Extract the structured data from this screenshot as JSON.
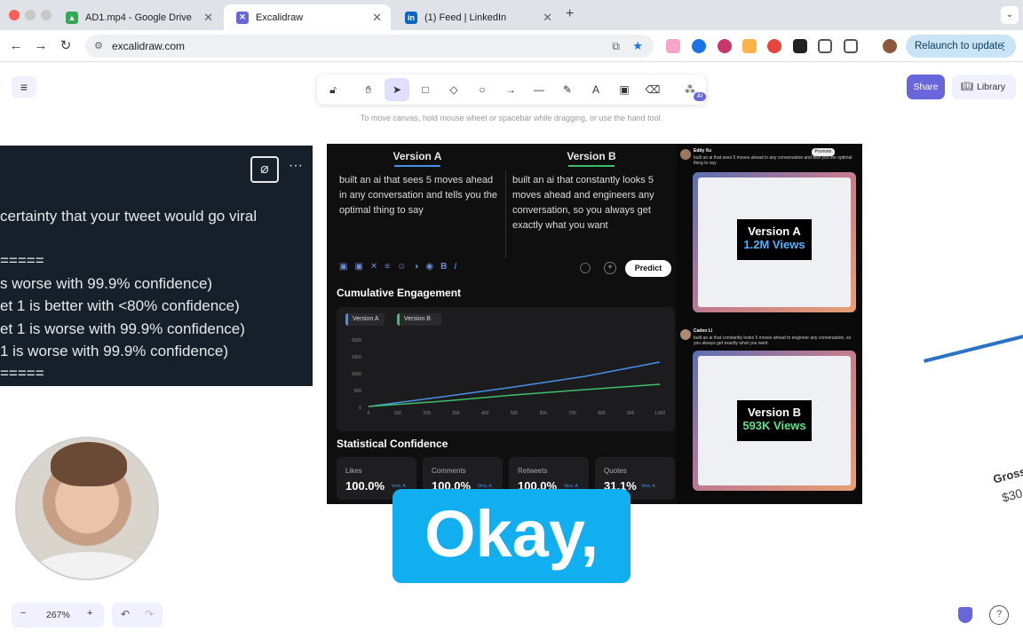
{
  "browser": {
    "tabs": [
      {
        "title": "AD1.mp4 - Google Drive",
        "active": false
      },
      {
        "title": "Excalidraw",
        "active": true
      },
      {
        "title": "(1) Feed | LinkedIn",
        "active": false
      }
    ],
    "url": "excalidraw.com",
    "relaunch_label": "Relaunch to update"
  },
  "excalidraw": {
    "hint": "To move canvas, hold mouse wheel or spacebar while dragging, or use the hand tool.",
    "share_label": "Share",
    "library_label": "Library",
    "zoom_level": "267%",
    "ai_badge": "AI"
  },
  "tweet_panel": {
    "lines": [
      "certainty that your tweet would go viral",
      "=====",
      "s worse with 99.9% confidence)",
      "et 1 is better with <80% confidence)",
      "et 1 is worse with 99.9% confidence)",
      "1 is worse with 99.9% confidence)",
      "====="
    ]
  },
  "screenshot": {
    "version_a_title": "Version A",
    "version_b_title": "Version B",
    "version_a_text": "built an ai that sees 5 moves ahead in any conversation and tells you the optimal thing to say",
    "version_b_text": "built an ai that constantly looks 5 moves ahead and engineers any conversation, so you always get exactly what you want",
    "predict_label": "Predict",
    "cumulative_title": "Cumulative Engagement",
    "stat_title": "Statistical Confidence",
    "chart": {
      "legend": [
        "Version A",
        "Version B"
      ],
      "y_ticks": [
        "2000",
        "1500",
        "1000",
        "500",
        "0"
      ],
      "x_ticks": [
        "0",
        "100",
        "200",
        "300",
        "400",
        "500",
        "600",
        "700",
        "800",
        "900",
        "1,000"
      ]
    },
    "stats": [
      {
        "label": "Likes",
        "value": "100.0%",
        "sub": "Vers. A"
      },
      {
        "label": "Comments",
        "value": "100.0%",
        "sub": "Vers. A"
      },
      {
        "label": "Retweets",
        "value": "100.0%",
        "sub": "Vers. A"
      },
      {
        "label": "Quotes",
        "value": "31.1%",
        "sub": "Vers. A"
      }
    ],
    "tweet_a": {
      "author": "Eddy Xu",
      "promote": "Promote",
      "views_title": "Version A",
      "views_value": "1.2M Views",
      "text": "built an ai that sees 5 moves ahead in any conversation and tells you the optimal thing to say"
    },
    "tweet_b": {
      "author": "Caden Li",
      "views_title": "Version B",
      "views_value": "593K Views",
      "text": "built an ai that constantly looks 5 moves ahead to engineer any conversation, so you always get exactly what you want."
    }
  },
  "right_edge_text": {
    "gross": "Gross",
    "amount": "$30"
  },
  "caption": "Okay,"
}
